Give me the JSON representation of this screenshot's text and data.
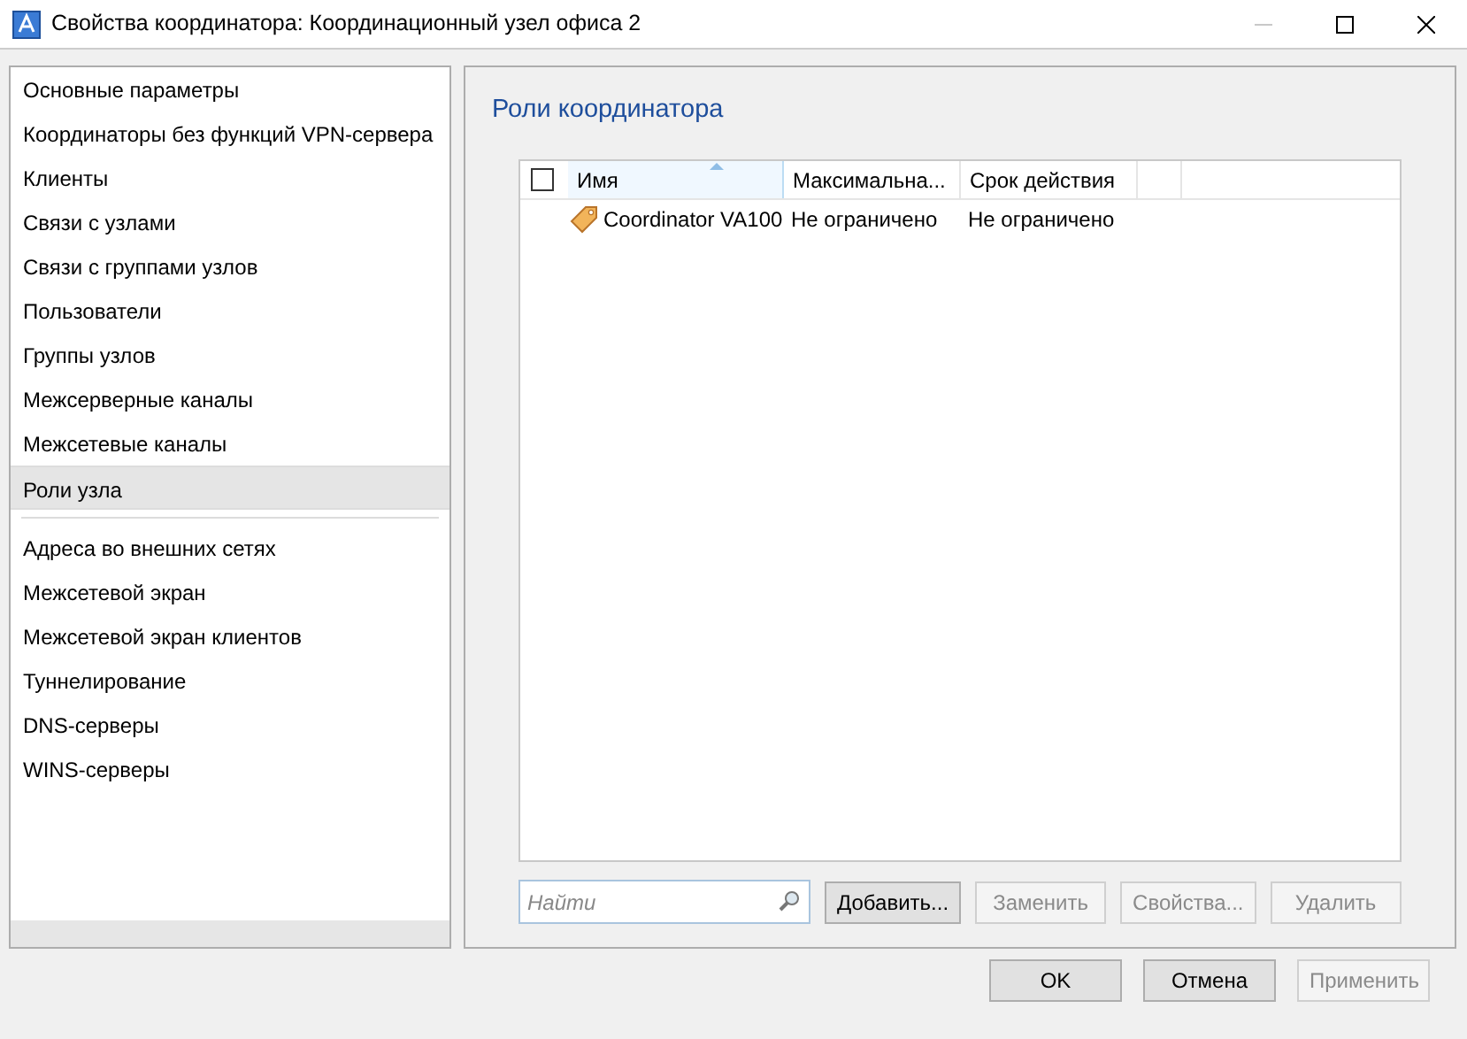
{
  "window": {
    "title": "Свойства координатора: Координационный узел офиса 2",
    "controls": [
      {
        "kind": "minimize",
        "disabled": true
      },
      {
        "kind": "maximize",
        "disabled": false
      },
      {
        "kind": "close",
        "disabled": false
      }
    ]
  },
  "sidebar": {
    "groups": [
      [
        {
          "label": "Основные параметры",
          "selected": false
        },
        {
          "label": "Координаторы без функций VPN-сервера",
          "selected": false
        },
        {
          "label": "Клиенты",
          "selected": false
        },
        {
          "label": "Связи с узлами",
          "selected": false
        },
        {
          "label": "Связи с группами узлов",
          "selected": false
        },
        {
          "label": "Пользователи",
          "selected": false
        },
        {
          "label": "Группы узлов",
          "selected": false
        },
        {
          "label": "Межсерверные каналы",
          "selected": false
        },
        {
          "label": "Межсетевые каналы",
          "selected": false
        },
        {
          "label": "Роли узла",
          "selected": true
        }
      ],
      [
        {
          "label": "Адреса во внешних сетях",
          "selected": false
        },
        {
          "label": "Межсетевой экран",
          "selected": false
        },
        {
          "label": "Межсетевой экран клиентов",
          "selected": false
        },
        {
          "label": "Туннелирование",
          "selected": false
        },
        {
          "label": "DNS-серверы",
          "selected": false
        },
        {
          "label": "WINS-серверы",
          "selected": false
        }
      ]
    ]
  },
  "panel": {
    "title": "Роли координатора",
    "table": {
      "select_all_checked": false,
      "columns": [
        {
          "label": "Имя",
          "sorted": true
        },
        {
          "label": "Максимальна...",
          "sorted": false
        },
        {
          "label": "Срок действия",
          "sorted": false
        }
      ],
      "rows": [
        {
          "cells": [
            "Coordinator VA100",
            "Не ограничено",
            "Не ограничено"
          ]
        }
      ]
    },
    "search": {
      "placeholder": "Найти"
    },
    "buttons": [
      {
        "label": "Добавить...",
        "disabled": false
      },
      {
        "label": "Заменить",
        "disabled": true
      },
      {
        "label": "Свойства...",
        "disabled": true
      },
      {
        "label": "Удалить",
        "disabled": true
      }
    ]
  },
  "footer_buttons": [
    {
      "label": "OK",
      "disabled": false
    },
    {
      "label": "Отмена",
      "disabled": false
    },
    {
      "label": "Применить",
      "disabled": true
    }
  ]
}
